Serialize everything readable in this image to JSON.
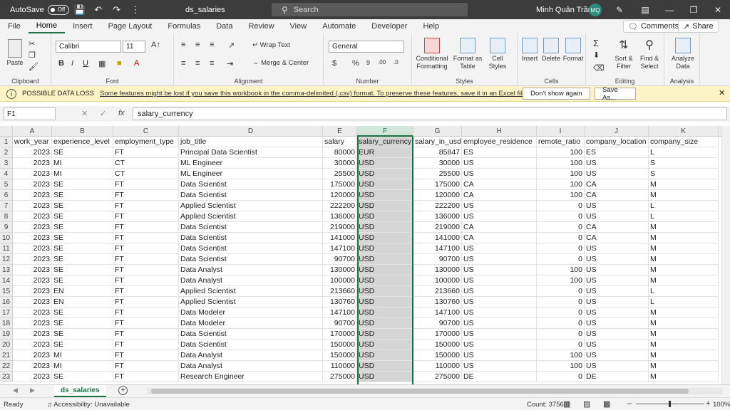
{
  "titlebar": {
    "autosave_label": "AutoSave",
    "autosave_state": "Off",
    "file_title": "ds_salaries",
    "search_placeholder": "Search",
    "user_name": "Minh Quân Trần",
    "user_initials": "MQ"
  },
  "menu": {
    "tabs": [
      "File",
      "Home",
      "Insert",
      "Page Layout",
      "Formulas",
      "Data",
      "Review",
      "View",
      "Automate",
      "Developer",
      "Help"
    ],
    "active": "Home",
    "comments_label": "Comments",
    "share_label": "Share"
  },
  "ribbon": {
    "clipboard_label": "Clipboard",
    "paste_label": "Paste",
    "font_label": "Font",
    "font_name": "Calibri",
    "font_size": "11",
    "alignment_label": "Alignment",
    "wrap_text": "Wrap Text",
    "merge_center": "Merge & Center",
    "number_label": "Number",
    "number_format": "General",
    "styles_label": "Styles",
    "conditional_formatting": "Conditional Formatting",
    "format_as_table": "Format as Table",
    "cell_styles": "Cell Styles",
    "cells_label": "Cells",
    "insert": "Insert",
    "delete": "Delete",
    "format": "Format",
    "editing_label": "Editing",
    "sort_filter": "Sort & Filter",
    "find_select": "Find & Select",
    "analysis_label": "Analysis",
    "analyze_data": "Analyze Data"
  },
  "infobar": {
    "title": "POSSIBLE DATA LOSS",
    "message": "Some features might be lost if you save this workbook in the comma-delimited (.csv) format. To preserve these features, save it in an Excel file format.",
    "dont_show": "Don't show again",
    "save_as": "Save As..."
  },
  "formula_bar": {
    "name_box": "F1",
    "formula": "salary_currency"
  },
  "sheet": {
    "columns": [
      "A",
      "B",
      "C",
      "D",
      "E",
      "F",
      "G",
      "H",
      "I",
      "J",
      "K"
    ],
    "selected_column": "F",
    "rows": [
      [
        "work_year",
        "experience_level",
        "employment_type",
        "job_title",
        "salary",
        "salary_currency",
        "salary_in_usd",
        "employee_residence",
        "remote_ratio",
        "company_location",
        "company_size"
      ],
      [
        "2023",
        "SE",
        "FT",
        "Principal Data Scientist",
        "80000",
        "EUR",
        "85847",
        "ES",
        "100",
        "ES",
        "L"
      ],
      [
        "2023",
        "MI",
        "CT",
        "ML Engineer",
        "30000",
        "USD",
        "30000",
        "US",
        "100",
        "US",
        "S"
      ],
      [
        "2023",
        "MI",
        "CT",
        "ML Engineer",
        "25500",
        "USD",
        "25500",
        "US",
        "100",
        "US",
        "S"
      ],
      [
        "2023",
        "SE",
        "FT",
        "Data Scientist",
        "175000",
        "USD",
        "175000",
        "CA",
        "100",
        "CA",
        "M"
      ],
      [
        "2023",
        "SE",
        "FT",
        "Data Scientist",
        "120000",
        "USD",
        "120000",
        "CA",
        "100",
        "CA",
        "M"
      ],
      [
        "2023",
        "SE",
        "FT",
        "Applied Scientist",
        "222200",
        "USD",
        "222200",
        "US",
        "0",
        "US",
        "L"
      ],
      [
        "2023",
        "SE",
        "FT",
        "Applied Scientist",
        "136000",
        "USD",
        "136000",
        "US",
        "0",
        "US",
        "L"
      ],
      [
        "2023",
        "SE",
        "FT",
        "Data Scientist",
        "219000",
        "USD",
        "219000",
        "CA",
        "0",
        "CA",
        "M"
      ],
      [
        "2023",
        "SE",
        "FT",
        "Data Scientist",
        "141000",
        "USD",
        "141000",
        "CA",
        "0",
        "CA",
        "M"
      ],
      [
        "2023",
        "SE",
        "FT",
        "Data Scientist",
        "147100",
        "USD",
        "147100",
        "US",
        "0",
        "US",
        "M"
      ],
      [
        "2023",
        "SE",
        "FT",
        "Data Scientist",
        "90700",
        "USD",
        "90700",
        "US",
        "0",
        "US",
        "M"
      ],
      [
        "2023",
        "SE",
        "FT",
        "Data Analyst",
        "130000",
        "USD",
        "130000",
        "US",
        "100",
        "US",
        "M"
      ],
      [
        "2023",
        "SE",
        "FT",
        "Data Analyst",
        "100000",
        "USD",
        "100000",
        "US",
        "100",
        "US",
        "M"
      ],
      [
        "2023",
        "EN",
        "FT",
        "Applied Scientist",
        "213660",
        "USD",
        "213660",
        "US",
        "0",
        "US",
        "L"
      ],
      [
        "2023",
        "EN",
        "FT",
        "Applied Scientist",
        "130760",
        "USD",
        "130760",
        "US",
        "0",
        "US",
        "L"
      ],
      [
        "2023",
        "SE",
        "FT",
        "Data Modeler",
        "147100",
        "USD",
        "147100",
        "US",
        "0",
        "US",
        "M"
      ],
      [
        "2023",
        "SE",
        "FT",
        "Data Modeler",
        "90700",
        "USD",
        "90700",
        "US",
        "0",
        "US",
        "M"
      ],
      [
        "2023",
        "SE",
        "FT",
        "Data Scientist",
        "170000",
        "USD",
        "170000",
        "US",
        "0",
        "US",
        "M"
      ],
      [
        "2023",
        "SE",
        "FT",
        "Data Scientist",
        "150000",
        "USD",
        "150000",
        "US",
        "0",
        "US",
        "M"
      ],
      [
        "2023",
        "MI",
        "FT",
        "Data Analyst",
        "150000",
        "USD",
        "150000",
        "US",
        "100",
        "US",
        "M"
      ],
      [
        "2023",
        "MI",
        "FT",
        "Data Analyst",
        "110000",
        "USD",
        "110000",
        "US",
        "100",
        "US",
        "M"
      ],
      [
        "2023",
        "SE",
        "FT",
        "Research Engineer",
        "275000",
        "USD",
        "275000",
        "DE",
        "0",
        "DE",
        "M"
      ]
    ]
  },
  "sheet_tab": "ds_salaries",
  "status": {
    "ready": "Ready",
    "accessibility": "Accessibility: Unavailable",
    "count": "Count: 3756",
    "zoom": "100%"
  },
  "colors": {
    "accent": "#1a7343",
    "titlebar": "#3c3c3c",
    "infobar": "#fdf3c4",
    "selection": "#d5d5d5"
  }
}
